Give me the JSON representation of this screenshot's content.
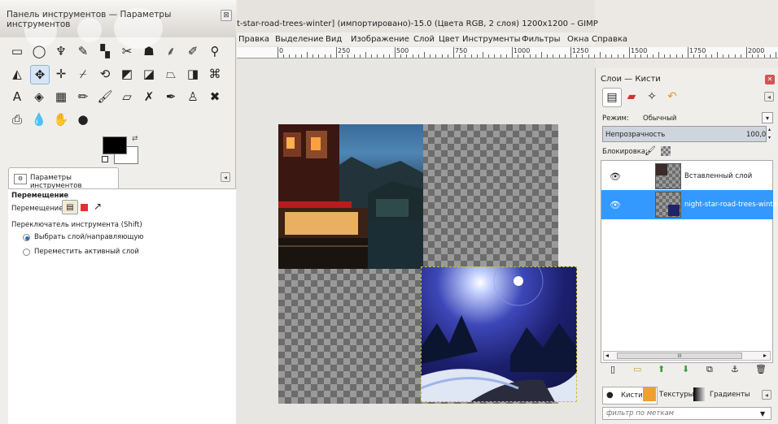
{
  "toolbox": {
    "title": "Панель инструментов — Параметры инструментов",
    "close_glyph": "⊠",
    "tools": [
      {
        "name": "rect-select-icon",
        "glyph": "▭"
      },
      {
        "name": "ellipse-select-icon",
        "glyph": "◯"
      },
      {
        "name": "free-select-icon",
        "glyph": "♆"
      },
      {
        "name": "fuzzy-select-icon",
        "glyph": "✎"
      },
      {
        "name": "color-select-icon",
        "glyph": "▚"
      },
      {
        "name": "scissors-icon",
        "glyph": "✂"
      },
      {
        "name": "foreground-select-icon",
        "glyph": "☗"
      },
      {
        "name": "paths-icon",
        "glyph": "⸙"
      },
      {
        "name": "color-picker-icon",
        "glyph": "✐"
      },
      {
        "name": "zoom-icon",
        "glyph": "⚲"
      },
      {
        "name": "measure-icon",
        "glyph": "◭"
      },
      {
        "name": "move-icon",
        "glyph": "✥"
      },
      {
        "name": "align-icon",
        "glyph": "✛"
      },
      {
        "name": "crop-icon",
        "glyph": "⌿"
      },
      {
        "name": "rotate-icon",
        "glyph": "⟲"
      },
      {
        "name": "scale-icon",
        "glyph": "◩"
      },
      {
        "name": "shear-icon",
        "glyph": "◪"
      },
      {
        "name": "perspective-icon",
        "glyph": "⏢"
      },
      {
        "name": "flip-icon",
        "glyph": "◨"
      },
      {
        "name": "cage-icon",
        "glyph": "⌘"
      },
      {
        "name": "text-icon",
        "glyph": "A"
      },
      {
        "name": "bucket-fill-icon",
        "glyph": "◈"
      },
      {
        "name": "blend-icon",
        "glyph": "▦"
      },
      {
        "name": "pencil-icon",
        "glyph": "✏"
      },
      {
        "name": "paintbrush-icon",
        "glyph": "🖌"
      },
      {
        "name": "eraser-icon",
        "glyph": "▱"
      },
      {
        "name": "airbrush-icon",
        "glyph": "✗"
      },
      {
        "name": "ink-icon",
        "glyph": "✒"
      },
      {
        "name": "clone-icon",
        "glyph": "♙"
      },
      {
        "name": "heal-icon",
        "glyph": "✖"
      },
      {
        "name": "perspective-clone-icon",
        "glyph": "⎙"
      },
      {
        "name": "blur-icon",
        "glyph": "💧"
      },
      {
        "name": "smudge-icon",
        "glyph": "✋"
      },
      {
        "name": "dodge-burn-icon",
        "glyph": "●"
      }
    ],
    "active_tool_index": 11,
    "colors": {
      "foreground": "#000000",
      "background": "#ffffff"
    },
    "options_tab_label": "Параметры инструментов",
    "options": {
      "heading": "Перемещение",
      "move_label": "Перемещение:",
      "switch_label": "Переключатель инструмента  (Shift)",
      "radio1": "Выбрать слой/направляющую",
      "radio2": "Переместить активный слой",
      "radio_selected": 0
    }
  },
  "image_window": {
    "title": "t-star-road-trees-winter] (импортировано)-15.0 (Цвета RGB, 2 слоя) 1200x1200 – GIMP",
    "menu": [
      "Правка",
      "Выделение",
      "Вид",
      "Изображение",
      "Слой",
      "Цвет",
      "Инструменты",
      "Фильтры",
      "Окна",
      "Справка"
    ],
    "ruler_labels": [
      "0",
      "250",
      "500",
      "750",
      "1000",
      "1250",
      "1500",
      "1750",
      "2000"
    ]
  },
  "dock": {
    "title": "Слои — Кисти",
    "close_glyph": "✕",
    "mode_label": "Режим:",
    "mode_value": "Обычный",
    "opacity_label": "Непрозрачность",
    "opacity_value": "100,0",
    "lock_label": "Блокировка:",
    "layers": [
      {
        "name": "Вставленный слой",
        "visible": true,
        "selected": false
      },
      {
        "name": "night-star-road-trees-winter.j",
        "visible": true,
        "selected": true
      }
    ],
    "brush_tabs": [
      "Кисти",
      "Текстуры",
      "Градиенты"
    ],
    "filter_placeholder": "фильтр по меткам"
  }
}
